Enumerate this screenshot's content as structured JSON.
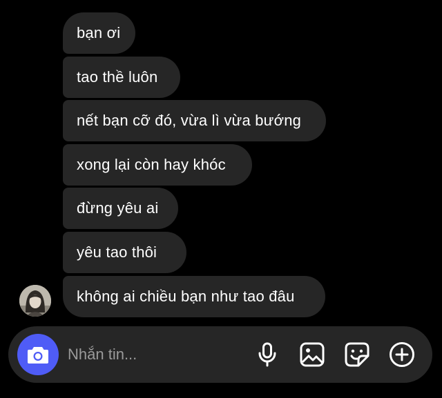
{
  "messages": [
    {
      "text": "bạn ơi"
    },
    {
      "text": "tao thề luôn"
    },
    {
      "text": "nết bạn cỡ đó, vừa lì vừa bướng"
    },
    {
      "text": "xong lại còn hay khóc"
    },
    {
      "text": "đừng yêu ai"
    },
    {
      "text": "yêu tao thôi"
    },
    {
      "text": "không ai chiều bạn như tao đâu"
    }
  ],
  "composer": {
    "placeholder": "Nhắn tin...",
    "value": "",
    "camera_icon": "camera-icon",
    "mic_icon": "microphone-icon",
    "gallery_icon": "image-icon",
    "sticker_icon": "sticker-icon",
    "more_icon": "plus-circle-icon"
  },
  "colors": {
    "background": "#000000",
    "bubble": "#262626",
    "composer": "#262626",
    "accent": "#4f5cf6",
    "text": "#ffffff",
    "placeholder": "#9a9a9a"
  }
}
